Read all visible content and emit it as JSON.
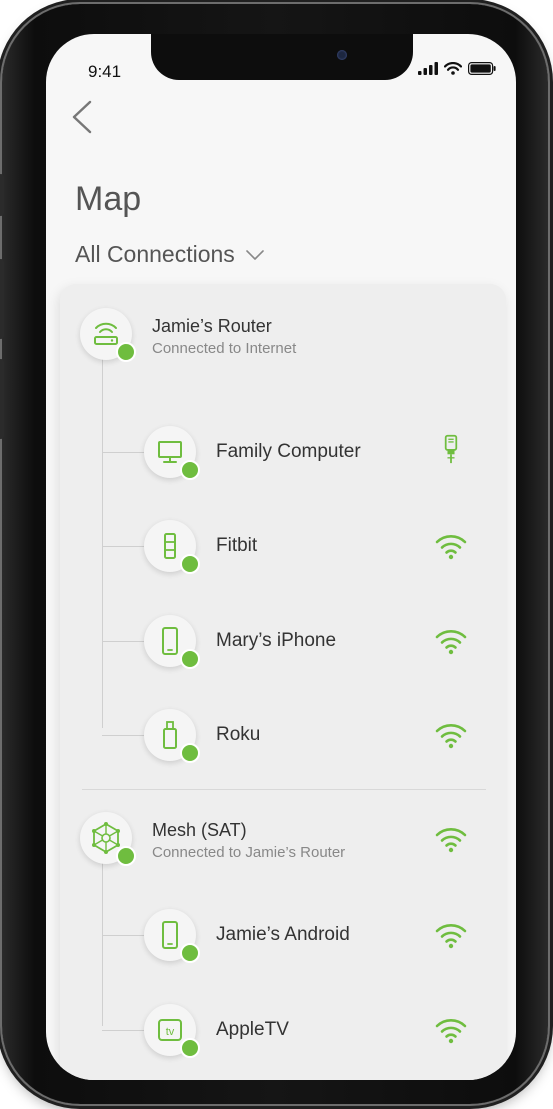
{
  "status": {
    "time": "9:41"
  },
  "page": {
    "title": "Map",
    "filter_label": "All Connections"
  },
  "colors": {
    "accent": "#6fbd3f",
    "text": "#333333",
    "subtext": "#888888"
  },
  "groups": [
    {
      "name": "Jamie’s Router",
      "subtitle": "Connected to Internet",
      "icon": "router-icon",
      "connection": "",
      "devices": [
        {
          "name": "Family Computer",
          "icon": "computer-icon",
          "connection": "ethernet-icon"
        },
        {
          "name": "Fitbit",
          "icon": "fitbit-icon",
          "connection": "wifi-icon"
        },
        {
          "name": "Mary’s iPhone",
          "icon": "phone-icon",
          "connection": "wifi-icon"
        },
        {
          "name": "Roku",
          "icon": "roku-stick-icon",
          "connection": "wifi-icon"
        }
      ]
    },
    {
      "name": "Mesh (SAT)",
      "subtitle": "Connected to Jamie’s Router",
      "icon": "mesh-icon",
      "connection": "wifi-icon",
      "devices": [
        {
          "name": "Jamie’s Android",
          "icon": "phone-icon",
          "connection": "wifi-icon"
        },
        {
          "name": "AppleTV",
          "icon": "appletv-icon",
          "connection": "wifi-icon"
        }
      ]
    }
  ]
}
